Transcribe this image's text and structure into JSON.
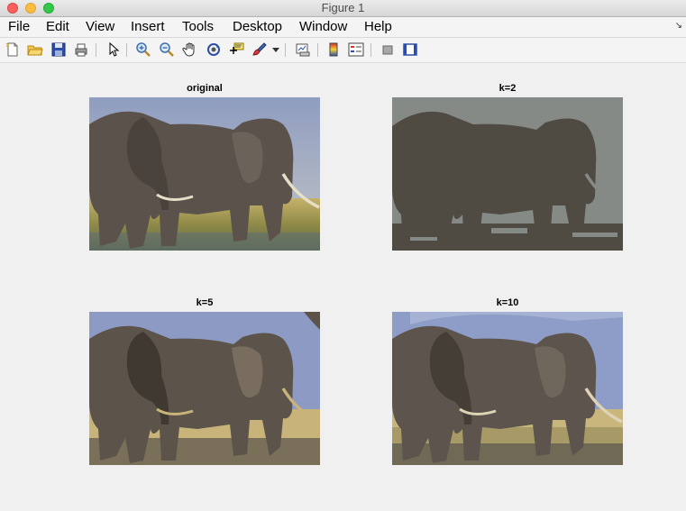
{
  "window": {
    "title": "Figure 1"
  },
  "menu": [
    "File",
    "Edit",
    "View",
    "Insert",
    "Tools",
    "Desktop",
    "Window",
    "Help"
  ],
  "toolbar": {
    "buttons": [
      "new-figure-icon",
      "open-file-icon",
      "save-icon",
      "print-icon",
      "pointer-icon",
      "zoom-in-icon",
      "zoom-out-icon",
      "pan-hand-icon",
      "rotate-3d-icon",
      "data-cursor-icon",
      "brush-icon",
      "link-plot-icon",
      "colorbar-icon",
      "legend-icon",
      "hide-plot-tools-icon",
      "show-plot-tools-icon"
    ]
  },
  "axes": [
    {
      "title": "original"
    },
    {
      "title": "k=2"
    },
    {
      "title": "k=5"
    },
    {
      "title": "k=10"
    }
  ],
  "colors": {
    "sky_original": "#8d9bbf",
    "grass_original": "#a89a5a",
    "elephant_original": "#5a524b",
    "k2_light": "#868a86",
    "k2_dark": "#4f4a42",
    "k5_sky": "#8c9ac4",
    "k5_grass": "#c8b47a",
    "k10_sky": "#8e9cc8"
  }
}
